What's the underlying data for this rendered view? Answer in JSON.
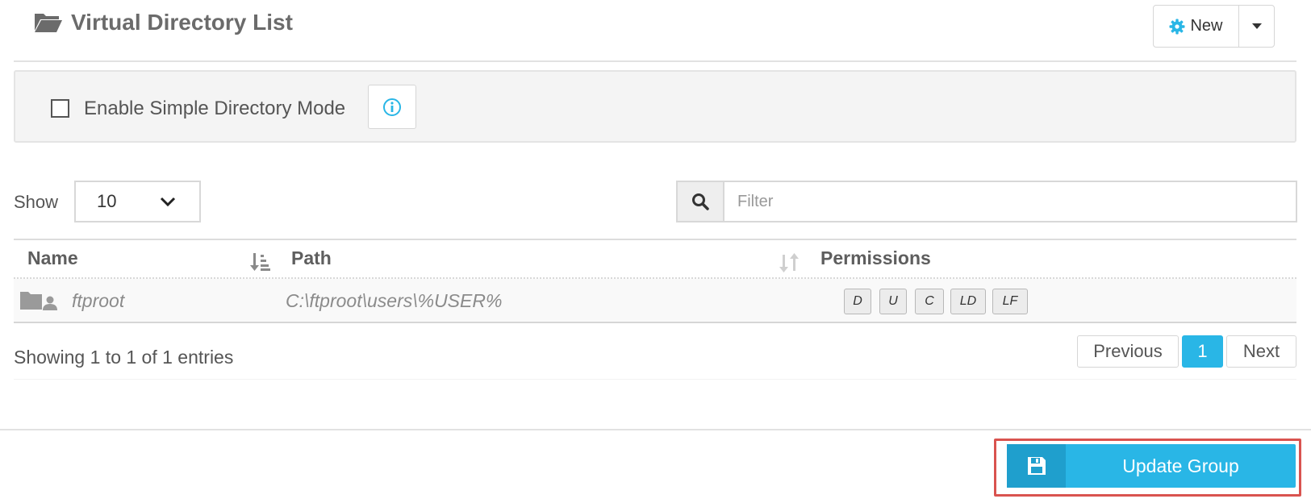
{
  "header": {
    "title": "Virtual Directory List",
    "title_icon": "folder-open-icon",
    "new_button": {
      "label": "New",
      "icon": "gear-icon"
    }
  },
  "mode_panel": {
    "checkbox_label": "Enable Simple Directory Mode",
    "checked": false,
    "info_icon": "info-icon"
  },
  "controls": {
    "show_label": "Show",
    "page_size": "10",
    "filter_placeholder": "Filter",
    "filter_value": ""
  },
  "table": {
    "columns": [
      "Name",
      "Path",
      "Permissions"
    ],
    "rows": [
      {
        "icon": "folder-user-icon",
        "name": "ftproot",
        "path": "C:\\ftproot\\users\\%USER%",
        "permissions": [
          "D",
          "U",
          "C",
          "LD",
          "LF"
        ]
      }
    ]
  },
  "footer": {
    "showing_text": "Showing 1 to 1 of 1 entries",
    "pagination": {
      "previous": "Previous",
      "current": "1",
      "next": "Next"
    }
  },
  "actions": {
    "update_label": "Update Group",
    "update_icon": "floppy-disk-icon"
  },
  "colors": {
    "accent": "#29b6e6",
    "accent_dark": "#1f9fcd",
    "highlight_outline": "#d9534f",
    "panel_bg": "#f4f4f4"
  }
}
